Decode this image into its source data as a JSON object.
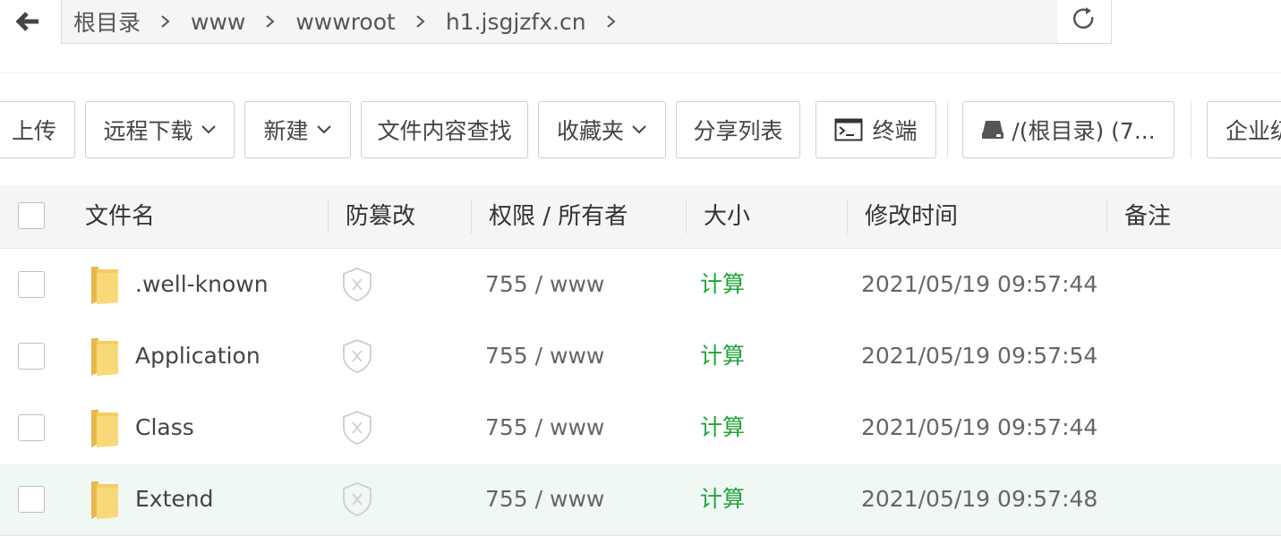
{
  "breadcrumbs": [
    {
      "label": "根目录"
    },
    {
      "label": "www"
    },
    {
      "label": "wwwroot"
    },
    {
      "label": "h1.jsgjzfx.cn"
    }
  ],
  "toolbar": {
    "upload": "上传",
    "remote_download": "远程下载",
    "new": "新建",
    "content_search": "文件内容查找",
    "favorites": "收藏夹",
    "share_list": "分享列表",
    "terminal": "终端",
    "disk": "/(根目录) (7...",
    "enterprise": "企业级"
  },
  "table": {
    "headers": {
      "name": "文件名",
      "tamper": "防篡改",
      "perm": "权限 / 所有者",
      "size": "大小",
      "mtime": "修改时间",
      "note": "备注"
    },
    "rows": [
      {
        "name": ".well-known",
        "perm": "755 / www",
        "size": "计算",
        "mtime": "2021/05/19 09:57:44"
      },
      {
        "name": "Application",
        "perm": "755 / www",
        "size": "计算",
        "mtime": "2021/05/19 09:57:54"
      },
      {
        "name": "Class",
        "perm": "755 / www",
        "size": "计算",
        "mtime": "2021/05/19 09:57:44"
      },
      {
        "name": "Extend",
        "perm": "755 / www",
        "size": "计算",
        "mtime": "2021/05/19 09:57:48"
      }
    ]
  },
  "colors": {
    "accent_green": "#20a53a",
    "row_hover": "#f0f8f4",
    "folder": "#f5d26b"
  },
  "icons": {
    "back": "arrow-left-icon",
    "refresh": "refresh-icon",
    "crumb_separator": "chevron-right-icon",
    "dropdown": "chevron-down-icon",
    "terminal": "terminal-icon",
    "disk": "disk-icon",
    "folder": "folder-icon",
    "tamper": "shield-x-icon"
  }
}
